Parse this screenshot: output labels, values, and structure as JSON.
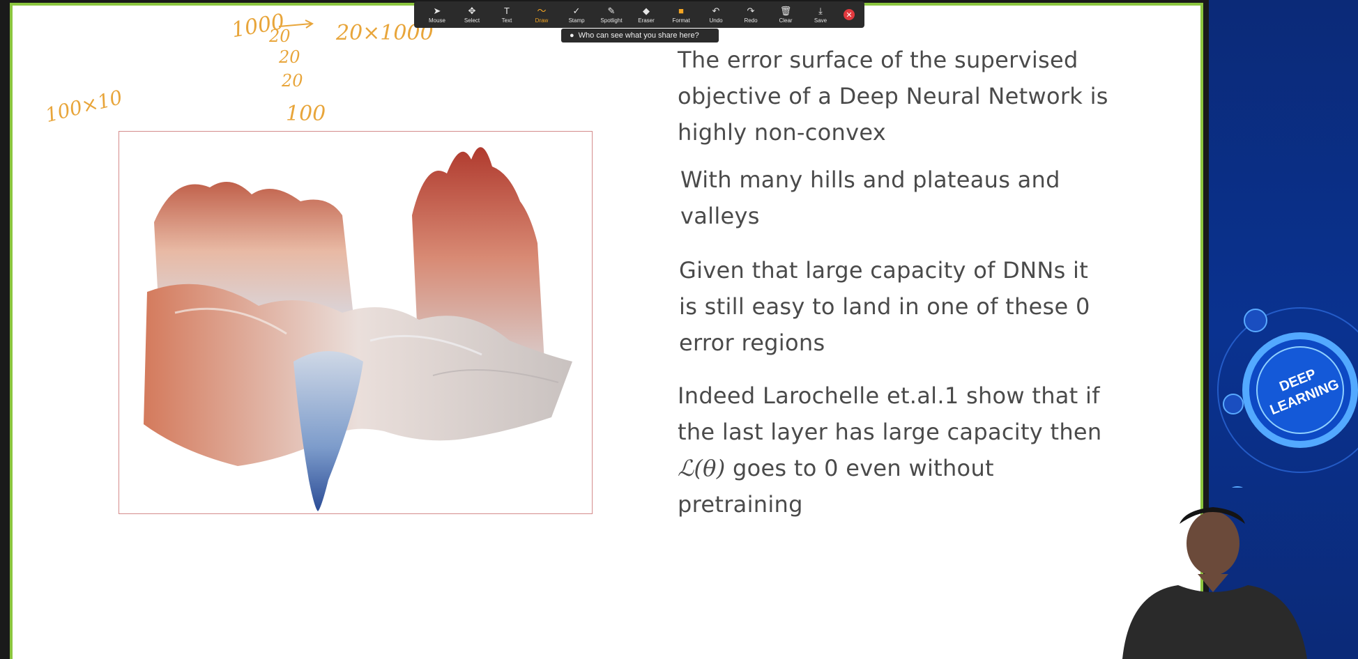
{
  "toolbar": {
    "tools": [
      {
        "label": "Mouse",
        "icon": "mouse-pointer-icon",
        "glyph": "➤"
      },
      {
        "label": "Select",
        "icon": "select-move-icon",
        "glyph": "✥"
      },
      {
        "label": "Text",
        "icon": "text-icon",
        "glyph": "T"
      },
      {
        "label": "Draw",
        "icon": "draw-squiggle-icon",
        "glyph": "〜"
      },
      {
        "label": "Stamp",
        "icon": "stamp-check-icon",
        "glyph": "✓"
      },
      {
        "label": "Spotlight",
        "icon": "spotlight-icon",
        "glyph": "✎"
      },
      {
        "label": "Eraser",
        "icon": "eraser-icon",
        "glyph": "◆"
      },
      {
        "label": "Format",
        "icon": "format-icon",
        "glyph": "■"
      },
      {
        "label": "Undo",
        "icon": "undo-icon",
        "glyph": "↶"
      },
      {
        "label": "Redo",
        "icon": "redo-icon",
        "glyph": "↷"
      },
      {
        "label": "Clear",
        "icon": "trash-icon",
        "glyph": "🗑"
      },
      {
        "label": "Save",
        "icon": "save-icon",
        "glyph": "⤓"
      }
    ],
    "active_tool": "Draw",
    "close_icon": "close-icon",
    "share_hint": "Who can see what you share here?"
  },
  "slide": {
    "bullets": {
      "b1": [
        "The error surface of the supervised",
        "objective of a Deep Neural Network is",
        "highly non-convex"
      ],
      "b2": [
        "With many hills and plateaus and",
        "valleys"
      ],
      "b3": [
        "Given that large capacity of DNNs it",
        "is still easy to land in one of these 0",
        "error regions"
      ],
      "b4_line1": "Indeed Larochelle et.al.1 show that if",
      "b4_line2": "the last layer has large capacity then",
      "b4_math": "ℒ(θ)",
      "b4_line3_rest": " goes to 0 even without",
      "b4_line4": "pretraining"
    },
    "annotations": [
      "1000",
      "20",
      "20",
      "20",
      "100",
      "20×1000",
      "100×10"
    ]
  },
  "side_panel": {
    "badge_line1": "DEEP",
    "badge_line2": "LEARNING"
  },
  "colors": {
    "border_green": "#8cc63f",
    "ink_orange": "#e8a53a",
    "toolbar_bg": "#2b2b2b",
    "active_orange": "#f5a623",
    "close_red": "#e0393e",
    "panel_blue": "#0b2a78"
  }
}
